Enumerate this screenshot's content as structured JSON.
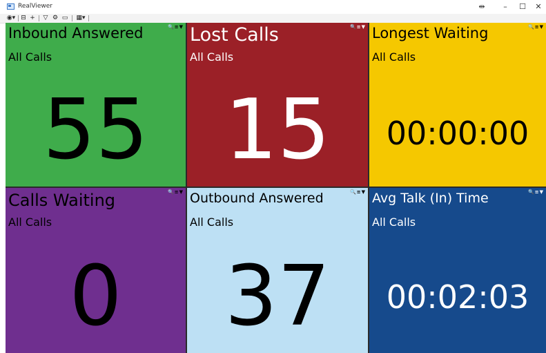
{
  "window": {
    "title": "RealViewer",
    "controls": {
      "restore": "⇹",
      "minimize": "–",
      "maximize": "☐",
      "close": "✕"
    }
  },
  "toolbar": {
    "icons": [
      "camera-icon",
      "save-icon",
      "add-icon",
      "filter-icon",
      "settings-icon",
      "display-icon",
      "layout-grid-icon"
    ],
    "glyphs": {
      "camera": "◉▾",
      "save": "⊟",
      "add": "+",
      "filter": "▽",
      "settings": "⚙",
      "display": "▭",
      "grid": "▦▾"
    }
  },
  "tiles": [
    {
      "title": "Inbound Answered",
      "subtitle": "All Calls",
      "value": "55",
      "bg": "#3fac4b",
      "fg": "#000000",
      "icons": "🔍≡▼"
    },
    {
      "title": "Lost Calls",
      "subtitle": "All Calls",
      "value": "15",
      "bg": "#9b2027",
      "fg": "#ffffff",
      "icons": "🔍≡▼"
    },
    {
      "title": "Longest Waiting",
      "subtitle": "All Calls",
      "value": "00:00:00",
      "bg": "#f5c800",
      "fg": "#000000",
      "icons": "🔍≡▼"
    },
    {
      "title": "Calls Waiting",
      "subtitle": "All Calls",
      "value": "0",
      "bg": "#6f2f8f",
      "fg": "#000000",
      "icons": "🔍≡▼"
    },
    {
      "title": "Outbound Answered",
      "subtitle": "All Calls",
      "value": "37",
      "bg": "#bde0f4",
      "fg": "#000000",
      "icons": "🔍≡▼"
    },
    {
      "title": "Avg Talk (In) Time",
      "subtitle": "All Calls",
      "value": "00:02:03",
      "bg": "#164a8c",
      "fg": "#ffffff",
      "icons": "🔍≡▼"
    }
  ]
}
